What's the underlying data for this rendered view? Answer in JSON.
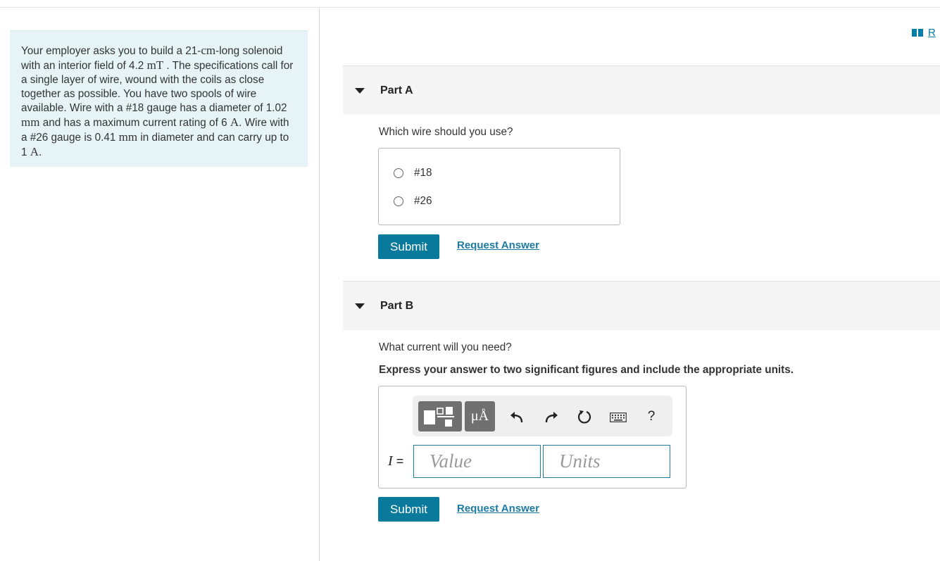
{
  "resource": {
    "label": "R",
    "icon": "book-icon"
  },
  "problem": {
    "p1": "Your employer asks you to build a 21-",
    "unit_cm": "cm",
    "p2": "-long solenoid with an interior field of 4.2 ",
    "unit_mT": "mT",
    "p3": " . The specifications call for a single layer of wire, wound with the coils as close together as possible. You have two spools of wire available. Wire with a #18 gauge has a diameter of 1.02 ",
    "unit_mm1": "mm",
    "p4": " and has a maximum current rating of 6 ",
    "unit_A1": "A",
    "p5": ". Wire with a #26 gauge is 0.41 ",
    "unit_mm2": "mm",
    "p6": " in diameter and can carry up to 1 ",
    "unit_A2": "A",
    "p7": "."
  },
  "partA": {
    "title": "Part A",
    "question": "Which wire should you use?",
    "options": [
      "#18",
      "#26"
    ],
    "submit": "Submit",
    "request": "Request Answer"
  },
  "partB": {
    "title": "Part B",
    "question": "What current will you need?",
    "instruction": "Express your answer to two significant figures and include the appropriate units.",
    "toolbar": {
      "units_label": "μÅ",
      "help_label": "?",
      "icons": [
        "templates-icon",
        "units-icon",
        "undo-icon",
        "redo-icon",
        "reset-icon",
        "keyboard-icon",
        "help-icon"
      ]
    },
    "variable": "I",
    "equals": "=",
    "value_placeholder": "Value",
    "units_placeholder": "Units",
    "submit": "Submit",
    "request": "Request Answer"
  },
  "colors": {
    "accent": "#0a7a9c",
    "link": "#1d7aa3",
    "problem_bg": "#e6f4f7",
    "part_header_bg": "#f5f5f5"
  }
}
